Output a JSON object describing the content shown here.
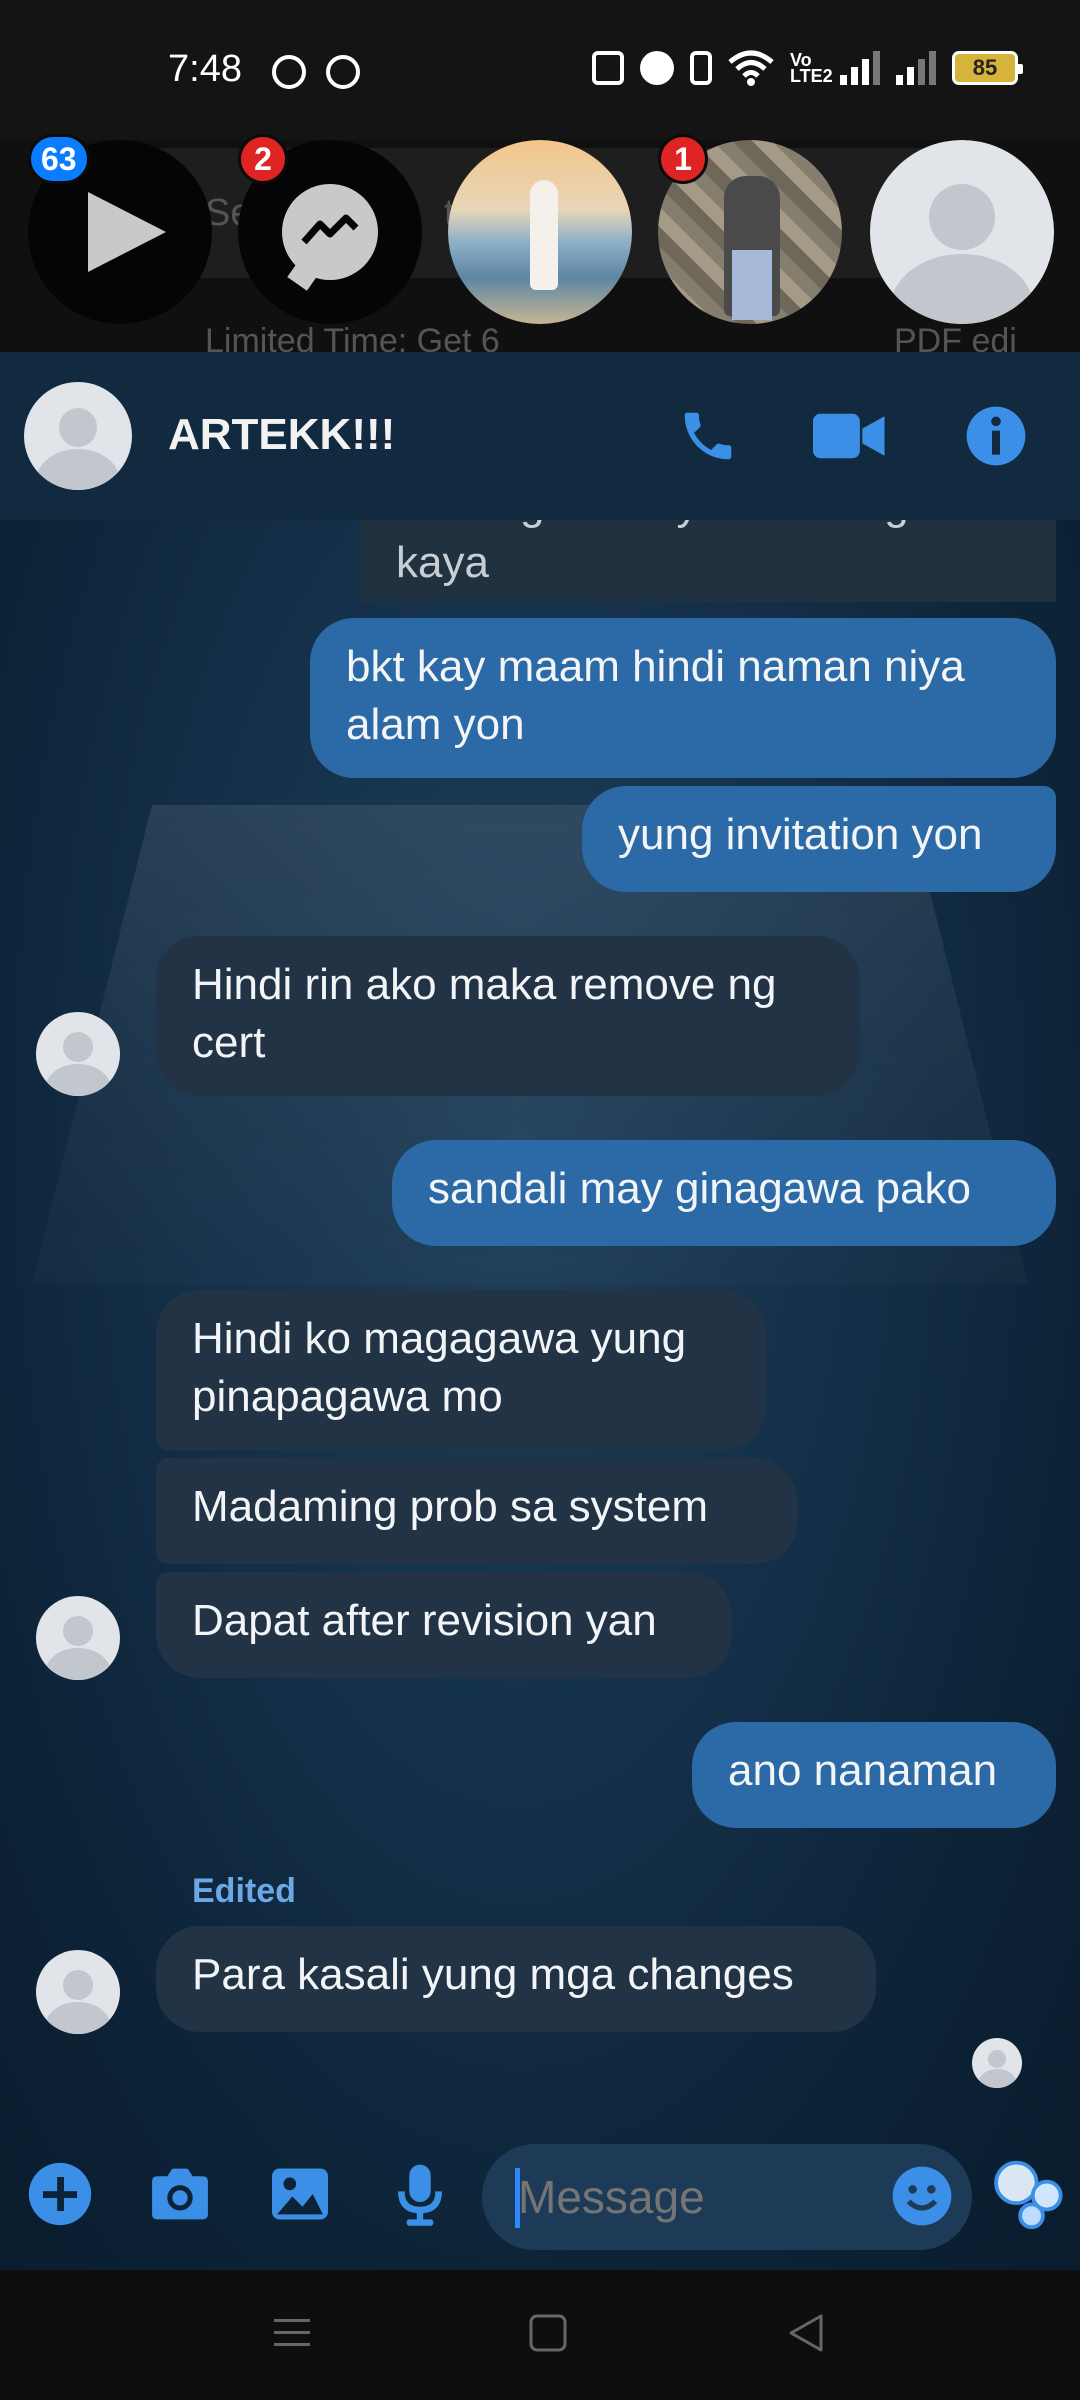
{
  "status_bar": {
    "time": "7:48",
    "battery": "85"
  },
  "background": {
    "search_text": "Se",
    "search_text_2": "t",
    "ad_left": "Limited Time: Get 6",
    "ad_right": "PDF edi"
  },
  "chat_heads": [
    {
      "badge": "63"
    },
    {
      "badge": "2"
    },
    {
      "badge": ""
    },
    {
      "badge": "1"
    },
    {
      "badge": ""
    }
  ],
  "header": {
    "name": "ARTEKK!!!"
  },
  "messages": [
    {
      "from": "me",
      "text": "Yaneng mo kay maam regina kaya"
    },
    {
      "from": "me",
      "text": "bkt kay maam hindi naman niya alam yon"
    },
    {
      "from": "me",
      "text": "yung invitation yon"
    },
    {
      "from": "them",
      "text": "Hindi rin ako maka remove ng cert"
    },
    {
      "from": "me",
      "text": "sandali may ginagawa pako"
    },
    {
      "from": "them",
      "text": "Hindi ko magagawa yung pinapagawa mo"
    },
    {
      "from": "them",
      "text": "Madaming prob sa system"
    },
    {
      "from": "them",
      "text": "Dapat after revision yan"
    },
    {
      "from": "me",
      "text": "ano nanaman"
    },
    {
      "from": "them",
      "text": "Para kasali yung mga changes",
      "edited": "Edited"
    }
  ],
  "composer": {
    "placeholder": "Message"
  },
  "colors": {
    "outgoing": "#2b6aa6",
    "incoming": "#213345",
    "accent": "#2f86ff",
    "header": "#122a3f"
  },
  "icons": [
    "phone-icon",
    "video-icon",
    "info-icon",
    "plus-icon",
    "camera-icon",
    "image-icon",
    "mic-icon",
    "emoji-icon",
    "bubbles-icon"
  ]
}
